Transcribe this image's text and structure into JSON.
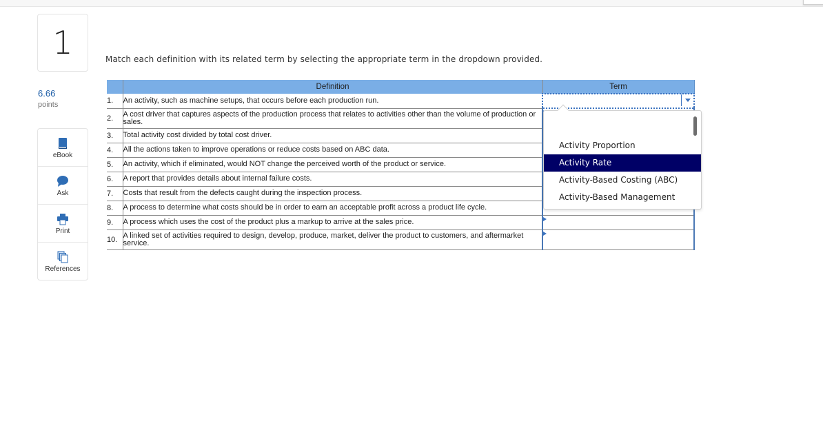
{
  "question": {
    "number": "1",
    "points_value": "6.66",
    "points_label": "points",
    "instruction": "Match each definition with its related term by selecting the appropriate term in the dropdown provided."
  },
  "tools": [
    {
      "label": "eBook",
      "icon": "book-icon"
    },
    {
      "label": "Ask",
      "icon": "chat-bubble-icon"
    },
    {
      "label": "Print",
      "icon": "printer-icon"
    },
    {
      "label": "References",
      "icon": "documents-icon"
    }
  ],
  "table": {
    "headers": {
      "number": "",
      "definition": "Definition",
      "term": "Term"
    },
    "rows": [
      {
        "num": "1.",
        "definition": "An activity, such as machine setups, that occurs before each production run.",
        "term": ""
      },
      {
        "num": "2.",
        "definition": "A cost driver that captures aspects of the production process that relates to activities other than the volume of production or sales.",
        "term": ""
      },
      {
        "num": "3.",
        "definition": "Total activity cost divided by total cost driver.",
        "term": ""
      },
      {
        "num": "4.",
        "definition": "All the actions taken to improve operations or reduce costs based on ABC data.",
        "term": ""
      },
      {
        "num": "5.",
        "definition": "An activity, which if eliminated, would NOT change the perceived worth of the product or service.",
        "term": ""
      },
      {
        "num": "6.",
        "definition": "A report that provides details about internal failure costs.",
        "term": ""
      },
      {
        "num": "7.",
        "definition": "Costs that result from the defects caught during the inspection process.",
        "term": ""
      },
      {
        "num": "8.",
        "definition": "A process to determine what costs should be in order to earn an acceptable profit across a product life cycle.",
        "term": ""
      },
      {
        "num": "9.",
        "definition": "A process which uses the cost of the product plus a markup to arrive at the sales price.",
        "term": ""
      },
      {
        "num": "10.",
        "definition": "A linked set of activities required to design, develop, produce, market, deliver the product to customers, and aftermarket service.",
        "term": ""
      }
    ]
  },
  "dropdown": {
    "options": [
      "Activity Proportion",
      "Activity Rate",
      "Activity-Based Costing (ABC)",
      "Activity-Based Management"
    ],
    "highlighted": "Activity Rate"
  },
  "colors": {
    "header_bg": "#7aaee6",
    "points_text": "#1f5fa8",
    "highlight_bg": "#000066",
    "focus_border": "#3b73c0"
  }
}
